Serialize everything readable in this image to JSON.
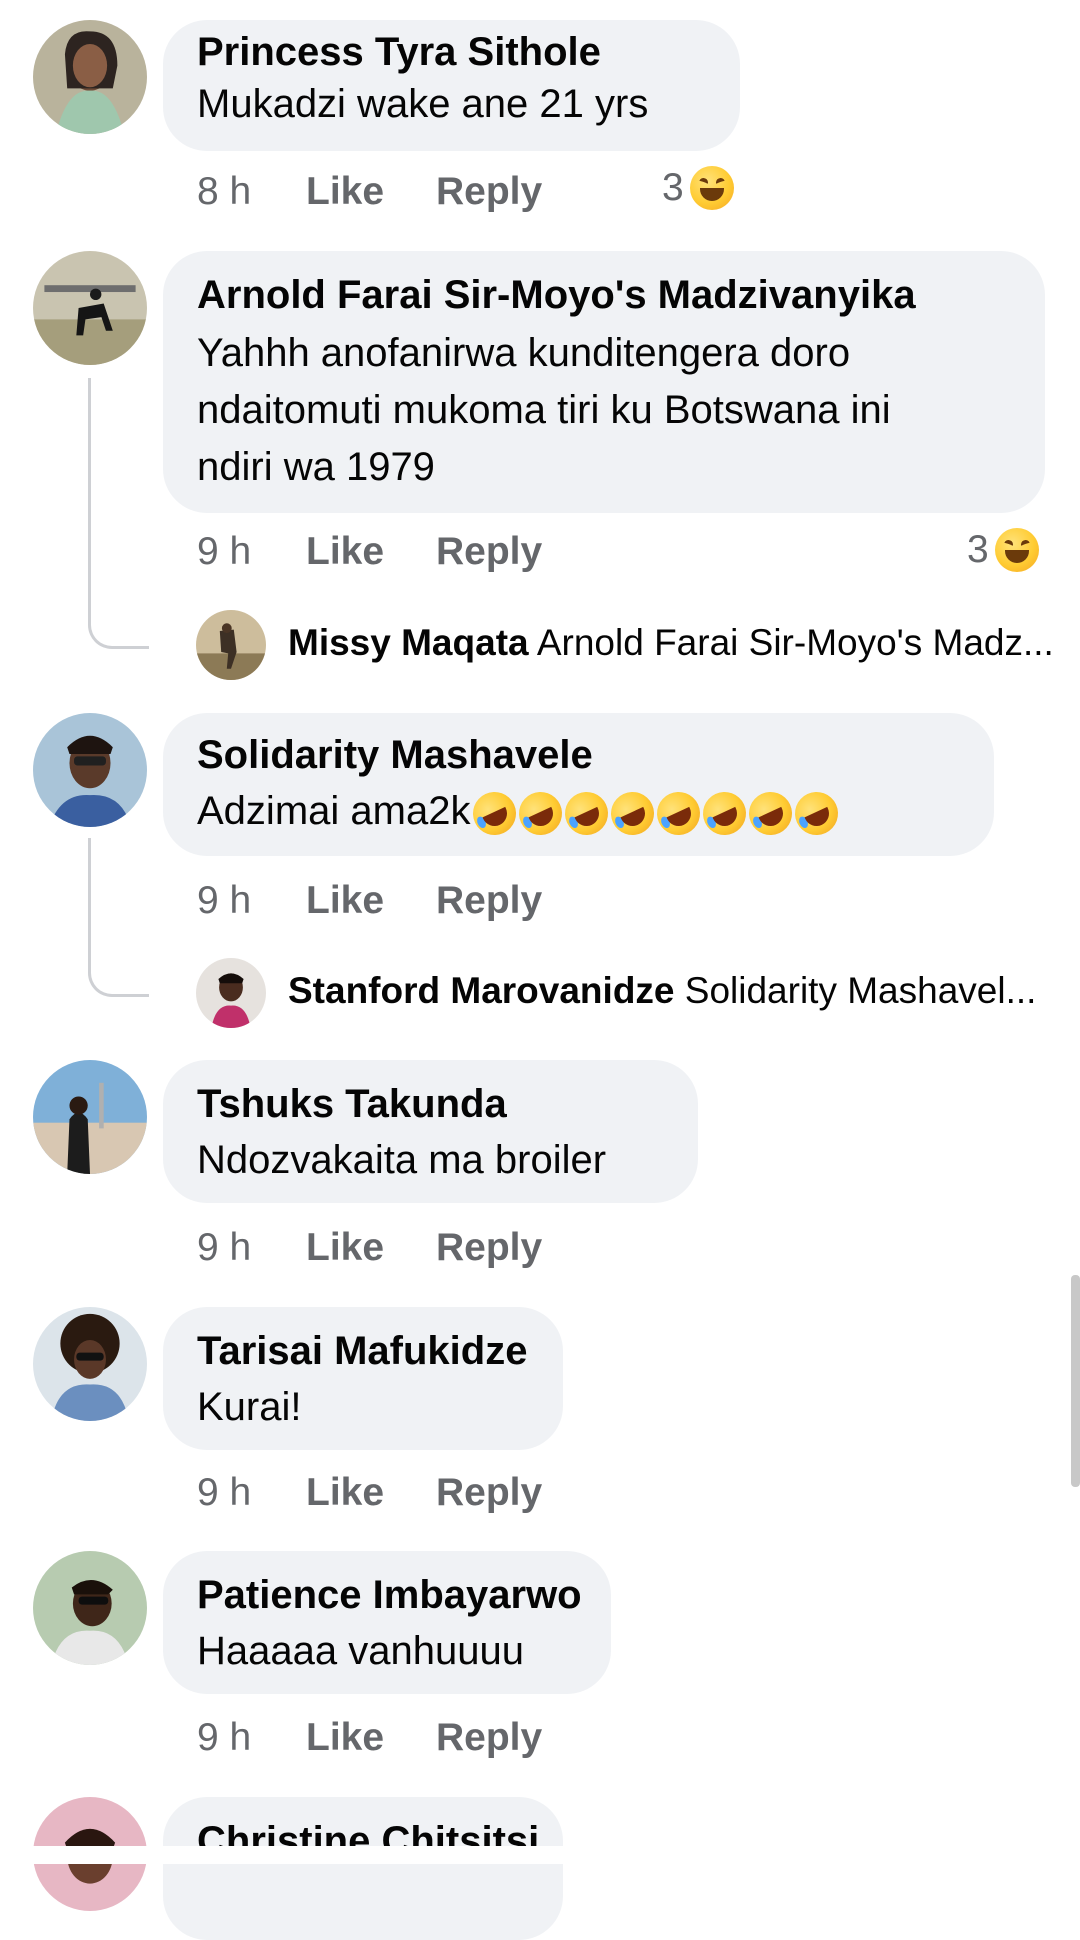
{
  "comments": [
    {
      "name": "Princess Tyra Sithole",
      "lines": [
        "Mukadzi wake ane 21 yrs"
      ],
      "time": "8 h",
      "like": "Like",
      "reply": "Reply",
      "reaction_count": "3"
    },
    {
      "name": "Arnold Farai Sir-Moyo's Madzivanyika",
      "lines": [
        "Yahhh anofanirwa kunditengera doro",
        "ndaitomuti mukoma tiri ku Botswana ini",
        "ndiri wa 1979"
      ],
      "time": "9 h",
      "like": "Like",
      "reply": "Reply",
      "reaction_count": "3",
      "reply_preview": {
        "name": "Missy Maqata",
        "text": "Arnold Farai Sir-Moyo's Madz..."
      }
    },
    {
      "name": "Solidarity Mashavele",
      "lines": [
        "Adzimai ama2k"
      ],
      "time": "9 h",
      "like": "Like",
      "reply": "Reply",
      "reply_preview": {
        "name": "Stanford Marovanidze",
        "text": "Solidarity Mashavel..."
      }
    },
    {
      "name": "Tshuks Takunda",
      "lines": [
        "Ndozvakaita ma broiler"
      ],
      "time": "9 h",
      "like": "Like",
      "reply": "Reply"
    },
    {
      "name": "Tarisai Mafukidze",
      "lines": [
        "Kurai!"
      ],
      "time": "9 h",
      "like": "Like",
      "reply": "Reply"
    },
    {
      "name": "Patience Imbayarwo",
      "lines": [
        "Haaaaa vanhuuuu"
      ],
      "time": "9 h",
      "like": "Like",
      "reply": "Reply"
    },
    {
      "name": "Christine Chitsitsi"
    }
  ],
  "reaction_icon": "laughing-face-icon",
  "inline_emoji": "rolling-on-floor-laughing-icon",
  "inline_emoji_count": 8,
  "colors": {
    "bubble": "#f0f2f5",
    "meta": "#65676b",
    "text": "#050505",
    "thread_line": "#ced0d4"
  }
}
